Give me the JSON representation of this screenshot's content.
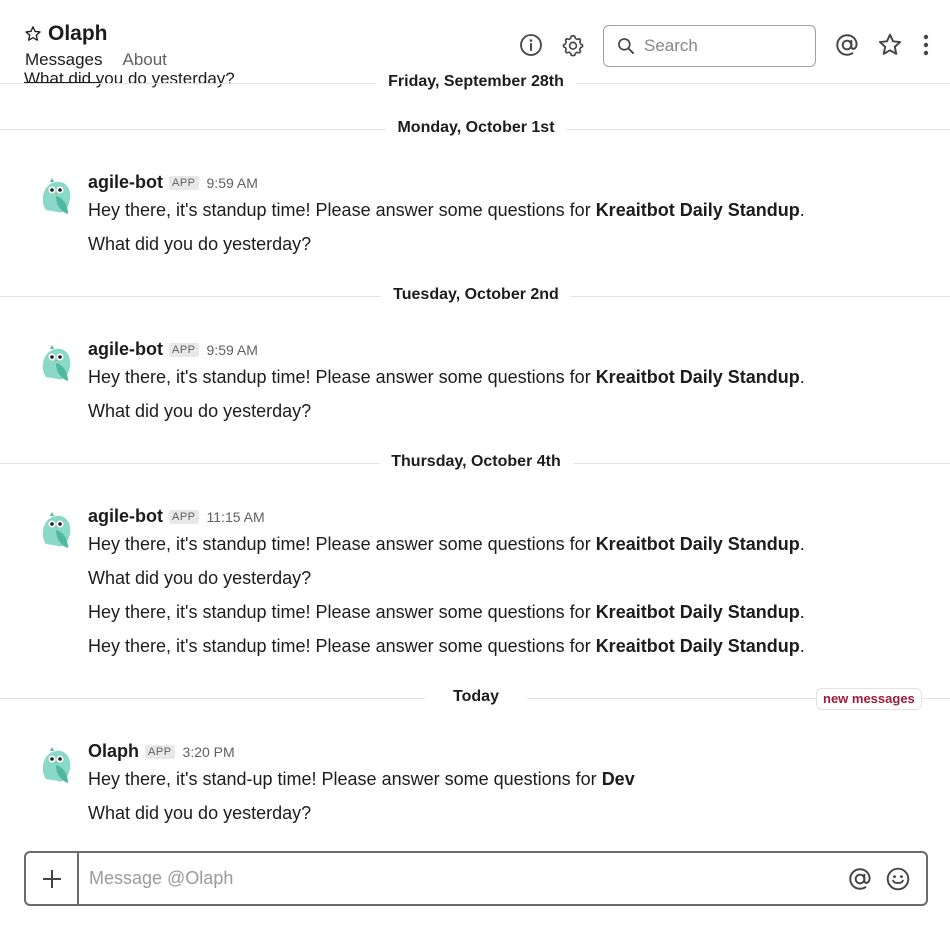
{
  "header": {
    "title": "Olaph",
    "tabs": [
      {
        "label": "Messages",
        "active": true
      },
      {
        "label": "About",
        "active": false
      }
    ],
    "search_placeholder": "Search",
    "icons": [
      "info-icon",
      "gear-icon",
      "search-icon",
      "mention-icon",
      "star-icon",
      "more-vertical-icon"
    ]
  },
  "messages": {
    "partial_text": "What did you do yesterday?",
    "dates": [
      "Friday, September 28th",
      "Monday, October 1st",
      "Tuesday, October 2nd",
      "Thursday, October 4th",
      "Today"
    ],
    "new_messages_label": "new messages",
    "groups": [
      {
        "author": "agile-bot",
        "badge": "APP",
        "time": "9:59 AM",
        "lines": [
          {
            "text": "Hey there, it's standup time! Please answer some questions for ",
            "bold": "Kreaitbot Daily Standup",
            "after": "."
          },
          {
            "text": "What did you do yesterday?",
            "bold": "",
            "after": ""
          }
        ]
      },
      {
        "author": "agile-bot",
        "badge": "APP",
        "time": "9:59 AM",
        "lines": [
          {
            "text": "Hey there, it's standup time! Please answer some questions for ",
            "bold": "Kreaitbot Daily Standup",
            "after": "."
          },
          {
            "text": "What did you do yesterday?",
            "bold": "",
            "after": ""
          }
        ]
      },
      {
        "author": "agile-bot",
        "badge": "APP",
        "time": "11:15 AM",
        "lines": [
          {
            "text": "Hey there, it's standup time! Please answer some questions for ",
            "bold": "Kreaitbot Daily Standup",
            "after": "."
          },
          {
            "text": "What did you do yesterday?",
            "bold": "",
            "after": ""
          },
          {
            "text": "Hey there, it's standup time! Please answer some questions for ",
            "bold": "Kreaitbot Daily Standup",
            "after": "."
          },
          {
            "text": "Hey there, it's standup time! Please answer some questions for ",
            "bold": "Kreaitbot Daily Standup",
            "after": "."
          }
        ]
      },
      {
        "author": "Olaph",
        "badge": "APP",
        "time": "3:20 PM",
        "lines": [
          {
            "text": "Hey there, it's stand-up time! Please answer some questions for ",
            "bold": "Dev",
            "after": ""
          },
          {
            "text": "What did you do yesterday?",
            "bold": "",
            "after": ""
          }
        ]
      }
    ]
  },
  "composer": {
    "placeholder": "Message @Olaph",
    "icons": [
      "plus-icon",
      "mention-icon",
      "emoji-icon"
    ]
  },
  "colors": {
    "accent_new_messages": "#9e1a3a",
    "avatar_teal": "#7fd3c2",
    "divider": "#e2e2e2"
  }
}
